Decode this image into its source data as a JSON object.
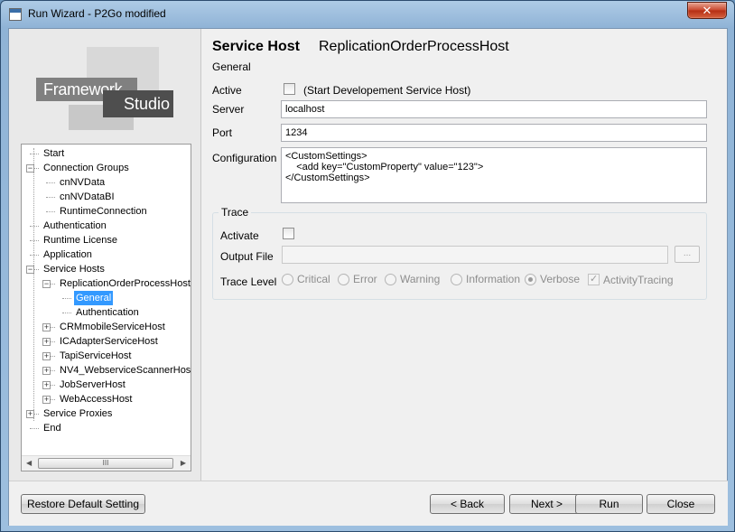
{
  "window": {
    "title": "Run Wizard - P2Go modified",
    "close_glyph": "✕"
  },
  "logo": {
    "word1": "Framework",
    "word2": "Studio"
  },
  "tree": {
    "items": [
      {
        "label": "Start",
        "level": 0
      },
      {
        "label": "Connection Groups",
        "level": 0
      },
      {
        "label": "cnNVData",
        "level": 1
      },
      {
        "label": "cnNVDataBI",
        "level": 1
      },
      {
        "label": "RuntimeConnection",
        "level": 1
      },
      {
        "label": "Authentication",
        "level": 0
      },
      {
        "label": "Runtime License",
        "level": 0
      },
      {
        "label": "Application",
        "level": 0
      },
      {
        "label": "Service Hosts",
        "level": 0
      },
      {
        "label": "ReplicationOrderProcessHost",
        "level": 1
      },
      {
        "label": "General",
        "level": 2,
        "selected": true
      },
      {
        "label": "Authentication",
        "level": 2
      },
      {
        "label": "CRMmobileServiceHost",
        "level": 1
      },
      {
        "label": "ICAdapterServiceHost",
        "level": 1
      },
      {
        "label": "TapiServiceHost",
        "level": 1
      },
      {
        "label": "NV4_WebserviceScannerHost",
        "level": 1
      },
      {
        "label": "JobServerHost",
        "level": 1
      },
      {
        "label": "WebAccessHost",
        "level": 1
      },
      {
        "label": "Service Proxies",
        "level": 0
      },
      {
        "label": "End",
        "level": 0
      }
    ],
    "scroll_grip": "III"
  },
  "header": {
    "title": "Service Host",
    "host_name": "ReplicationOrderProcessHost",
    "subtitle": "General"
  },
  "form": {
    "active_label": "Active",
    "active_checked": false,
    "active_hint": "(Start Developement Service Host)",
    "server_label": "Server",
    "server_value": "localhost",
    "port_label": "Port",
    "port_value": "1234",
    "config_label": "Configuration",
    "config_value": "<CustomSettings>\n    <add key=\"CustomProperty\" value=\"123\">\n</CustomSettings>"
  },
  "trace": {
    "group_title": "Trace",
    "activate_label": "Activate",
    "activate_checked": false,
    "output_label": "Output File",
    "output_value": "",
    "browse_label": "...",
    "level_label": "Trace Level",
    "levels": [
      "Critical",
      "Error",
      "Warning",
      "Information",
      "Verbose"
    ],
    "selected_level": "Verbose",
    "activity_label": "ActivityTracing",
    "activity_checked": true
  },
  "buttons": {
    "restore": "Restore Default Setting",
    "back": "< Back",
    "next": "Next >",
    "run": "Run",
    "close": "Close"
  }
}
